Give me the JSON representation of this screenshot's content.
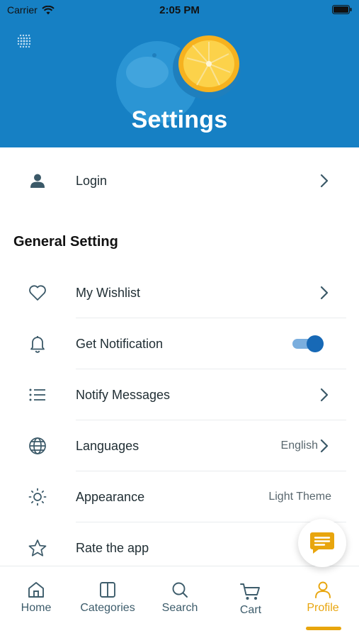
{
  "status_bar": {
    "carrier": "Carrier",
    "time": "2:05 PM"
  },
  "header": {
    "title": "Settings"
  },
  "login": {
    "label": "Login"
  },
  "general": {
    "title": "General Setting",
    "items": [
      {
        "label": "My Wishlist",
        "icon": "heart-icon"
      },
      {
        "label": "Get Notification",
        "icon": "bell-icon",
        "toggle_on": true
      },
      {
        "label": "Notify Messages",
        "icon": "list-icon"
      },
      {
        "label": "Languages",
        "icon": "globe-icon",
        "value": "English"
      },
      {
        "label": "Appearance",
        "icon": "sun-icon",
        "value": "Light Theme"
      },
      {
        "label": "Rate the app",
        "icon": "star-icon"
      }
    ]
  },
  "tabs": [
    {
      "label": "Home",
      "icon": "home-icon"
    },
    {
      "label": "Categories",
      "icon": "categories-icon"
    },
    {
      "label": "Search",
      "icon": "search-icon"
    },
    {
      "label": "Cart",
      "icon": "cart-icon"
    },
    {
      "label": "Profile",
      "icon": "profile-icon",
      "active": true
    }
  ],
  "colors": {
    "header_blue": "#1680c4",
    "accent": "#e8a50d",
    "toggle_blue": "#1769b6",
    "text": "#1f2d33"
  }
}
